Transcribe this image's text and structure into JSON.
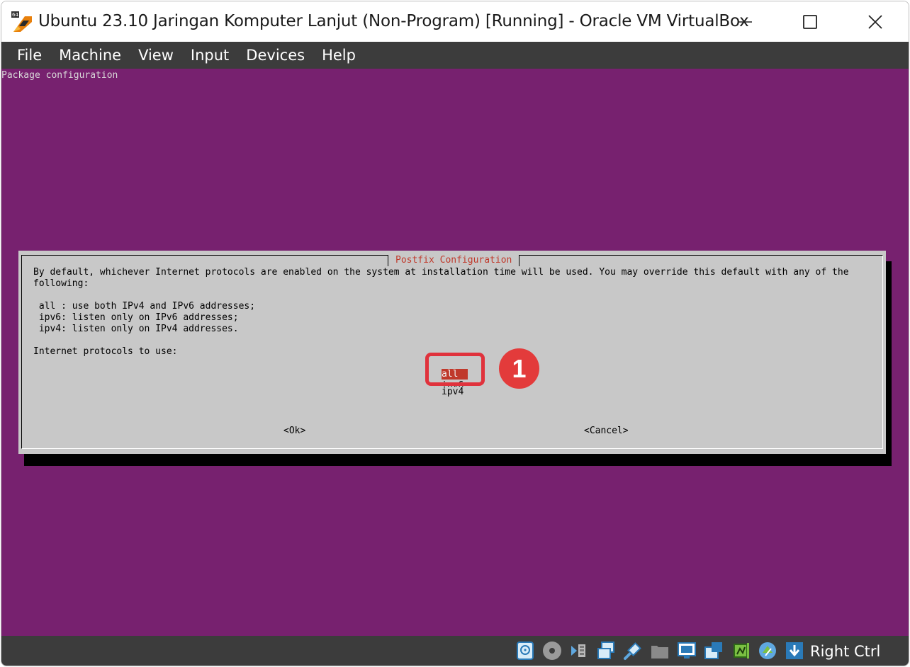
{
  "window": {
    "title": "Ubuntu 23.10 Jaringan Komputer Lanjut (Non-Program) [Running] - Oracle VM VirtualBox"
  },
  "menubar": {
    "items": [
      {
        "label": "File"
      },
      {
        "label": "Machine"
      },
      {
        "label": "View"
      },
      {
        "label": "Input"
      },
      {
        "label": "Devices"
      },
      {
        "label": "Help"
      }
    ]
  },
  "vm_screen": {
    "header": "Package configuration",
    "dialog": {
      "title": "Postfix Configuration",
      "body": "By default, whichever Internet protocols are enabled on the system at installation time will be used. You may override this default with any of the following:\n\n all : use both IPv4 and IPv6 addresses;\n ipv6: listen only on IPv6 addresses;\n ipv4: listen only on IPv4 addresses.\n\nInternet protocols to use:",
      "options": [
        {
          "label": "all",
          "selected": true
        },
        {
          "label": "ipv6",
          "selected": false
        },
        {
          "label": "ipv4",
          "selected": false
        }
      ],
      "ok_label": "<Ok>",
      "cancel_label": "<Cancel>"
    }
  },
  "annotation": {
    "step_number": "1"
  },
  "statusbar": {
    "icons": [
      "hard-disk-icon",
      "optical-drive-icon",
      "audio-icon",
      "network-icon",
      "usb-icon",
      "shared-folders-icon",
      "display-icon",
      "capture-icon",
      "cpu-icon",
      "mouse-integration-icon",
      "keyboard-icon"
    ],
    "host_key": "Right Ctrl"
  },
  "colors": {
    "vm_background": "#77216f",
    "dialog_background": "#c8c8c8",
    "selection": "#c0392b",
    "annotation": "#e33b3b"
  }
}
